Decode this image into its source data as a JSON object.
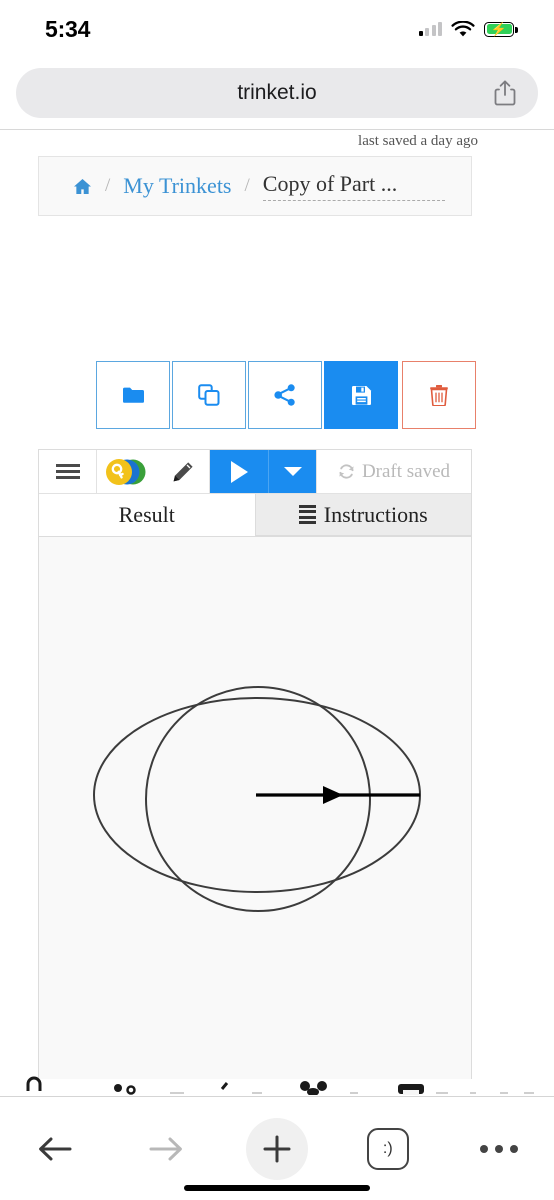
{
  "status_bar": {
    "time": "5:34",
    "signal_icon": "cellular-signal-icon",
    "wifi_icon": "wifi-icon",
    "battery_icon": "battery-charging-icon",
    "battery_color": "#30d158"
  },
  "browser": {
    "url": "trinket.io",
    "share_icon": "share-icon",
    "bottom": {
      "back_icon": "back-arrow-icon",
      "forward_icon": "forward-arrow-icon",
      "new_tab_icon": "plus-icon",
      "tabs_icon": "tabs-icon",
      "tabs_label": ":)",
      "more_icon": "more-ellipsis-icon"
    }
  },
  "page": {
    "last_saved": "last saved a day ago",
    "breadcrumb": {
      "home_icon": "home-icon",
      "separator": "/",
      "my_trinkets": "My Trinkets",
      "title": "Copy of Part ..."
    },
    "actions": [
      {
        "name": "folder-button",
        "icon": "folder-icon",
        "style": "outline",
        "color": "#1a8cf0"
      },
      {
        "name": "copy-button",
        "icon": "copy-icon",
        "style": "outline",
        "color": "#1a8cf0"
      },
      {
        "name": "share-button",
        "icon": "share-nodes-icon",
        "style": "outline",
        "color": "#1a8cf0"
      },
      {
        "name": "save-button",
        "icon": "floppy-disk-icon",
        "style": "filled",
        "color": "#1a8cf0"
      },
      {
        "name": "delete-button",
        "icon": "trash-icon",
        "style": "danger",
        "color": "#e05c3e"
      }
    ],
    "trinket": {
      "menu_icon": "hamburger-menu-icon",
      "logo_icon": "trinket-logo-icon",
      "edit_icon": "pencil-icon",
      "run_icon": "play-icon",
      "caret_icon": "chevron-down-icon",
      "status_icon": "refresh-icon",
      "status_text": "Draft saved",
      "tabs": [
        {
          "label": "Result",
          "active": true,
          "icon": null
        },
        {
          "label": "Instructions",
          "active": false,
          "icon": "list-icon"
        }
      ],
      "canvas": {
        "background": "#f9f9f9",
        "stroke": "#3c3c3c",
        "description": "turtle-graphics-drawing"
      }
    }
  }
}
